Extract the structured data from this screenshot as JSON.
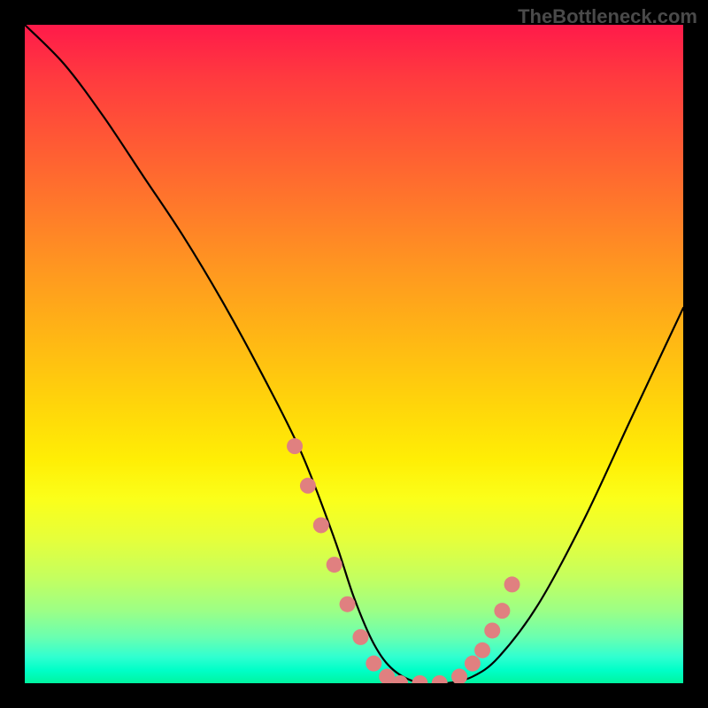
{
  "watermark": "TheBottleneck.com",
  "chart_data": {
    "type": "line",
    "title": "",
    "xlabel": "",
    "ylabel": "",
    "xlim": [
      0,
      100
    ],
    "ylim": [
      0,
      100
    ],
    "series": [
      {
        "name": "bottleneck-curve",
        "x": [
          0,
          6,
          12,
          18,
          24,
          30,
          36,
          42,
          47,
          50,
          53,
          56,
          60,
          64,
          68,
          72,
          78,
          85,
          92,
          100
        ],
        "y": [
          100,
          94,
          86,
          77,
          68,
          58,
          47,
          35,
          22,
          13,
          6,
          2,
          0,
          0,
          1,
          4,
          12,
          25,
          40,
          57
        ]
      }
    ],
    "markers": {
      "name": "highlight-dots",
      "color": "#e08080",
      "points": [
        {
          "x": 41,
          "y": 36
        },
        {
          "x": 43,
          "y": 30
        },
        {
          "x": 45,
          "y": 24
        },
        {
          "x": 47,
          "y": 18
        },
        {
          "x": 49,
          "y": 12
        },
        {
          "x": 51,
          "y": 7
        },
        {
          "x": 53,
          "y": 3
        },
        {
          "x": 55,
          "y": 1
        },
        {
          "x": 57,
          "y": 0
        },
        {
          "x": 60,
          "y": 0
        },
        {
          "x": 63,
          "y": 0
        },
        {
          "x": 66,
          "y": 1
        },
        {
          "x": 68,
          "y": 3
        },
        {
          "x": 69.5,
          "y": 5
        },
        {
          "x": 71,
          "y": 8
        },
        {
          "x": 72.5,
          "y": 11
        },
        {
          "x": 74,
          "y": 15
        }
      ]
    },
    "gradient_stops": [
      {
        "pos": 0,
        "color": "#ff1a4a"
      },
      {
        "pos": 50,
        "color": "#ffd60a"
      },
      {
        "pos": 80,
        "color": "#e6ff3a"
      },
      {
        "pos": 100,
        "color": "#00f5a0"
      }
    ]
  }
}
